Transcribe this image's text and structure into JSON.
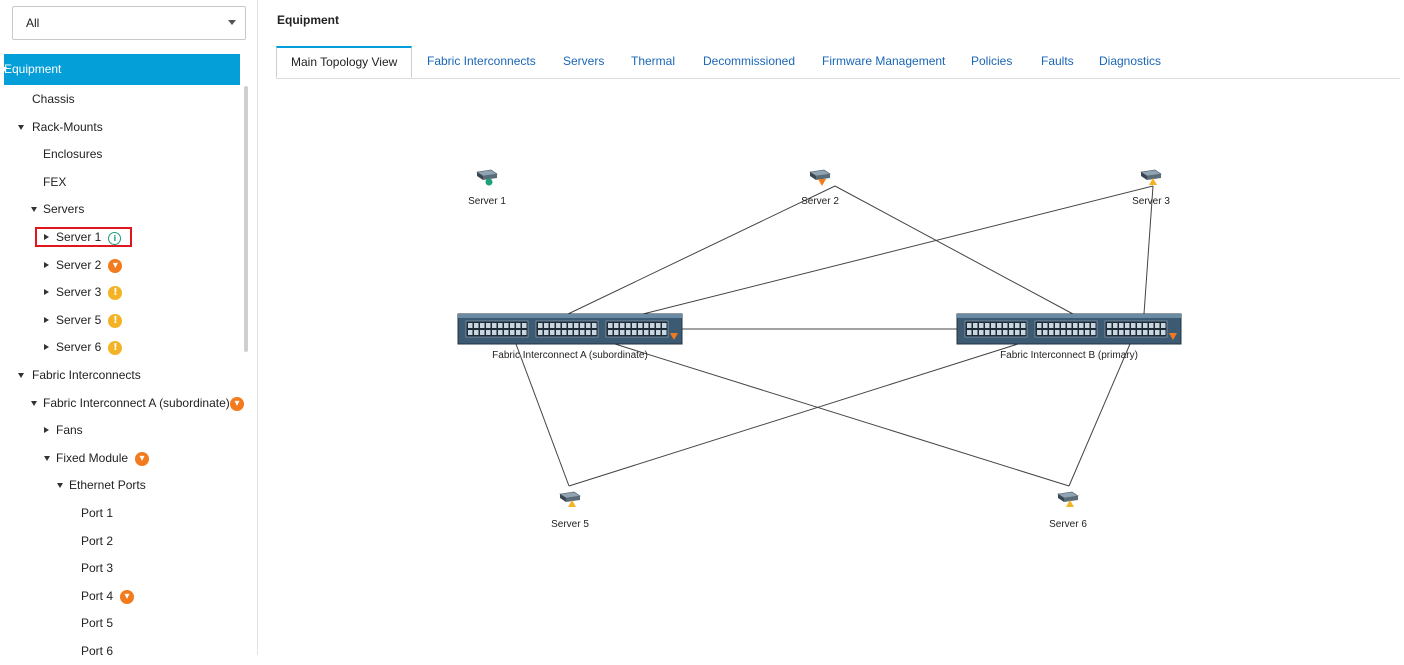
{
  "filter": {
    "value": "All"
  },
  "nav": {
    "items": [
      {
        "label": "Equipment",
        "name": "nav-equipment",
        "indent": 0,
        "tri": "down",
        "selected": true
      },
      {
        "label": "Chassis",
        "name": "nav-chassis",
        "indent": 1
      },
      {
        "label": "Rack-Mounts",
        "name": "nav-rack-mounts",
        "indent": 1,
        "tri": "down"
      },
      {
        "label": "Enclosures",
        "name": "nav-enclosures",
        "indent": 2
      },
      {
        "label": "FEX",
        "name": "nav-fex",
        "indent": 2
      },
      {
        "label": "Servers",
        "name": "nav-servers",
        "indent": 2,
        "tri": "down"
      },
      {
        "label": "Server 1",
        "name": "nav-server-1",
        "indent": 3,
        "tri": "right",
        "badge": "info"
      },
      {
        "label": "Server 2",
        "name": "nav-server-2",
        "indent": 3,
        "tri": "right",
        "badge": "major"
      },
      {
        "label": "Server 3",
        "name": "nav-server-3",
        "indent": 3,
        "tri": "right",
        "badge": "minor"
      },
      {
        "label": "Server 5",
        "name": "nav-server-5",
        "indent": 3,
        "tri": "right",
        "badge": "minor"
      },
      {
        "label": "Server 6",
        "name": "nav-server-6",
        "indent": 3,
        "tri": "right",
        "badge": "minor"
      },
      {
        "label": "Fabric Interconnects",
        "name": "nav-fabric-interconnects",
        "indent": 1,
        "tri": "down"
      },
      {
        "label": "Fabric Interconnect A (subordinate)",
        "name": "nav-fabric-interconnect-a",
        "indent": 2,
        "tri": "down",
        "badge": "major"
      },
      {
        "label": "Fans",
        "name": "nav-fans",
        "indent": 3,
        "tri": "right"
      },
      {
        "label": "Fixed Module",
        "name": "nav-fixed-module",
        "indent": 3,
        "tri": "down",
        "badge": "major"
      },
      {
        "label": "Ethernet Ports",
        "name": "nav-ethernet-ports",
        "indent": 4,
        "tri": "down"
      },
      {
        "label": "Port 1",
        "name": "nav-port-1",
        "indent": 5
      },
      {
        "label": "Port 2",
        "name": "nav-port-2",
        "indent": 5
      },
      {
        "label": "Port 3",
        "name": "nav-port-3",
        "indent": 5
      },
      {
        "label": "Port 4",
        "name": "nav-port-4",
        "indent": 5,
        "badge": "major"
      },
      {
        "label": "Port 5",
        "name": "nav-port-5",
        "indent": 5
      },
      {
        "label": "Port 6",
        "name": "nav-port-6",
        "indent": 5
      }
    ]
  },
  "main": {
    "title": "Equipment",
    "tabs": [
      {
        "label": "Main Topology View",
        "active": true
      },
      {
        "label": "Fabric Interconnects"
      },
      {
        "label": "Servers"
      },
      {
        "label": "Thermal"
      },
      {
        "label": "Decommissioned"
      },
      {
        "label": "Firmware Management"
      },
      {
        "label": "Policies"
      },
      {
        "label": "Faults"
      },
      {
        "label": "Diagnostics"
      }
    ]
  },
  "topology": {
    "servers": [
      {
        "id": "s1",
        "label": "Server 1",
        "status": "info"
      },
      {
        "id": "s2",
        "label": "Server 2",
        "status": "major"
      },
      {
        "id": "s3",
        "label": "Server 3",
        "status": "minor"
      },
      {
        "id": "s5",
        "label": "Server 5",
        "status": "minor"
      },
      {
        "id": "s6",
        "label": "Server 6",
        "status": "minor"
      }
    ],
    "fabric_interconnects": [
      {
        "id": "fiA",
        "label": "Fabric Interconnect A (subordinate)",
        "status": "major"
      },
      {
        "id": "fiB",
        "label": "Fabric Interconnect B (primary)",
        "status": "major"
      }
    ],
    "links": [
      [
        "s2",
        "fiA"
      ],
      [
        "s2",
        "fiB"
      ],
      [
        "s3",
        "fiA"
      ],
      [
        "s3",
        "fiB"
      ],
      [
        "fiA",
        "fiB"
      ],
      [
        "s5",
        "fiA"
      ],
      [
        "s5",
        "fiB"
      ],
      [
        "s6",
        "fiA"
      ],
      [
        "s6",
        "fiB"
      ]
    ]
  },
  "colors": {
    "accent": "#049fd9",
    "link": "#1a66b7",
    "major": "#f27b1e",
    "minor": "#f4b324",
    "info": "#1ca07a",
    "highlight": "#e0161c"
  },
  "icons": {
    "major": "down-triangle",
    "minor": "warning",
    "info": "info-circle"
  }
}
